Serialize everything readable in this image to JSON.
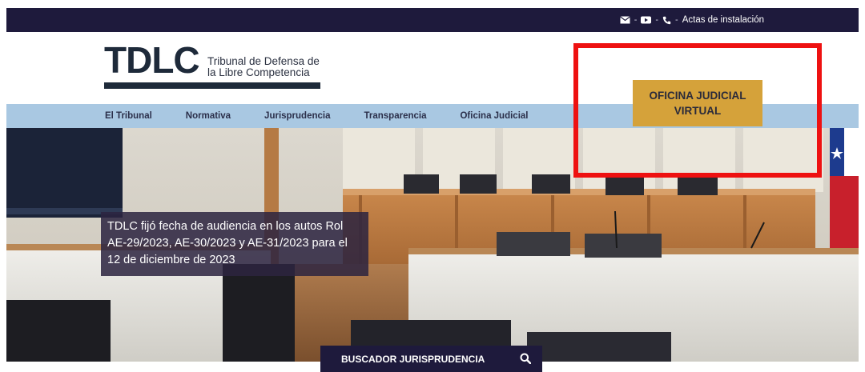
{
  "topbar": {
    "icons": [
      "mail-icon",
      "youtube-icon",
      "phone-icon"
    ],
    "separator": "-",
    "actas_label": "Actas de instalación"
  },
  "logo": {
    "mark": "TDLC",
    "line1": "Tribunal de Defensa de",
    "line2": "la Libre Competencia"
  },
  "nav": {
    "items": [
      "El Tribunal",
      "Normativa",
      "Jurisprudencia",
      "Transparencia",
      "Oficina Judicial"
    ]
  },
  "hero": {
    "caption": "TDLC fijó fecha de audiencia en los autos Rol AE-29/2023, AE-30/2023 y AE-31/2023 para el 12 de diciembre de 2023"
  },
  "cta": {
    "line1": "OFICINA JUDICIAL",
    "line2": "VIRTUAL"
  },
  "search": {
    "label": "BUSCADOR JURISPRUDENCIA",
    "icon": "search-icon"
  },
  "colors": {
    "topbar": "#1e1a3c",
    "nav": "#a9c8e2",
    "cta": "#d5a23a",
    "highlight": "#ee1111"
  }
}
